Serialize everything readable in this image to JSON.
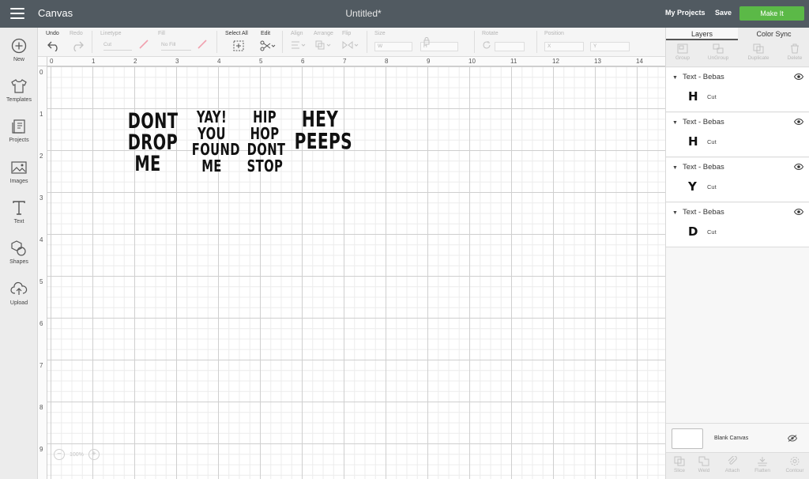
{
  "header": {
    "app_title": "Canvas",
    "doc_title": "Untitled*",
    "my_projects": "My Projects",
    "save": "Save",
    "make_it": "Make It",
    "colors": {
      "bar": "#515a61",
      "make_it": "#5bb947"
    }
  },
  "sidebar": {
    "items": [
      {
        "label": "New",
        "icon": "plus-circle-icon"
      },
      {
        "label": "Templates",
        "icon": "tshirt-icon"
      },
      {
        "label": "Projects",
        "icon": "projects-icon"
      },
      {
        "label": "Images",
        "icon": "image-icon"
      },
      {
        "label": "Text",
        "icon": "text-icon"
      },
      {
        "label": "Shapes",
        "icon": "shapes-icon"
      },
      {
        "label": "Upload",
        "icon": "upload-cloud-icon"
      }
    ]
  },
  "toolbar": {
    "undo": "Undo",
    "redo": "Redo",
    "linetype": "Linetype",
    "linetype_value": "Cut",
    "fill": "Fill",
    "fill_value": "No Fill",
    "select_all": "Select All",
    "edit": "Edit",
    "align": "Align",
    "arrange": "Arrange",
    "flip": "Flip",
    "size": "Size",
    "size_w": "W",
    "size_h": "H",
    "rotate": "Rotate",
    "position": "Position",
    "position_x": "X",
    "position_y": "Y"
  },
  "canvas": {
    "ruler_x": [
      "0",
      "1",
      "2",
      "3",
      "4",
      "5",
      "6",
      "7",
      "8",
      "9",
      "10",
      "11",
      "12",
      "13",
      "14"
    ],
    "ruler_y": [
      "0",
      "1",
      "2",
      "3",
      "4",
      "5",
      "6",
      "7",
      "8",
      "9"
    ],
    "texts": [
      {
        "lines": [
          "DONT",
          "DROP",
          "ME"
        ]
      },
      {
        "lines": [
          "YAY!",
          "YOU",
          "FOUND",
          "ME"
        ]
      },
      {
        "lines": [
          "HIP",
          "HOP",
          "DONT",
          "STOP"
        ]
      },
      {
        "lines": [
          "HEY",
          "PEEPS"
        ]
      }
    ],
    "zoom": "100%"
  },
  "right_panel": {
    "tabs": [
      "Layers",
      "Color Sync"
    ],
    "actions": [
      "Group",
      "UnGroup",
      "Duplicate",
      "Delete"
    ],
    "layers": [
      {
        "title": "Text - Bebas",
        "glyph": "H",
        "op": "Cut"
      },
      {
        "title": "Text - Bebas",
        "glyph": "H",
        "op": "Cut"
      },
      {
        "title": "Text - Bebas",
        "glyph": "Y",
        "op": "Cut"
      },
      {
        "title": "Text - Bebas",
        "glyph": "D",
        "op": "Cut"
      }
    ],
    "blank_canvas": "Blank Canvas",
    "bottom_actions": [
      "Slice",
      "Weld",
      "Attach",
      "Flatten",
      "Contour"
    ]
  }
}
